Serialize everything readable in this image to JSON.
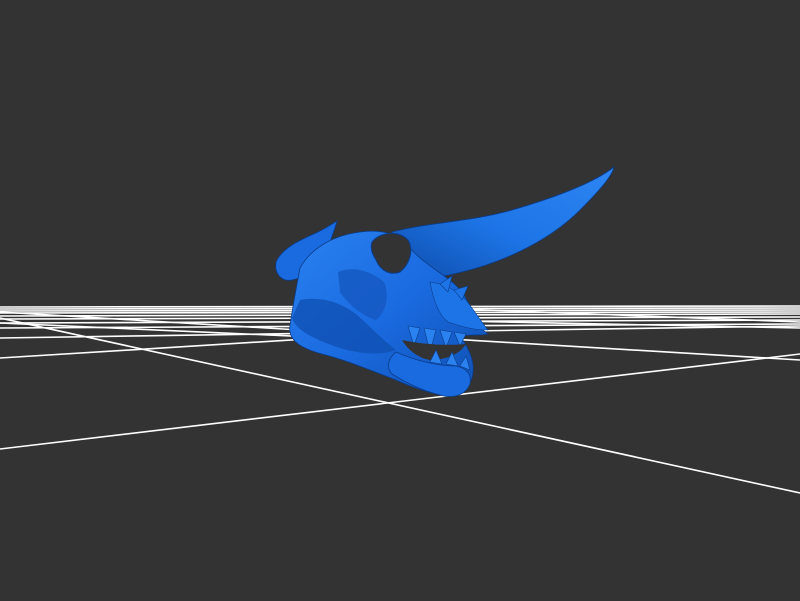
{
  "viewer": {
    "background_color": "#333333",
    "grid_color": "#ffffff",
    "model_color": "#1a6fe0",
    "model_shade_dark": "#0c3f8f",
    "model_shade_mid": "#1558c0",
    "model_highlight": "#3d8ff5",
    "model_name": "horned-skull-model"
  }
}
